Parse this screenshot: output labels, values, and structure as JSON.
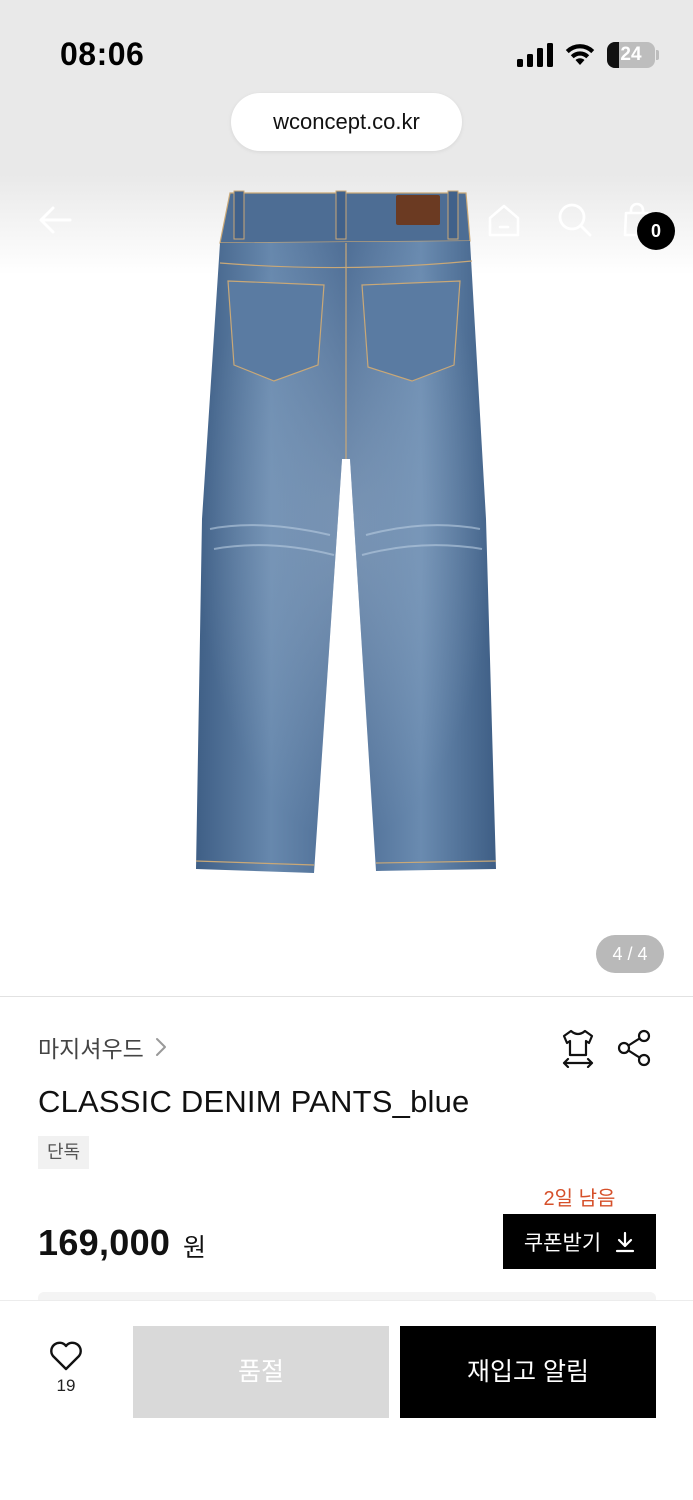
{
  "status_bar": {
    "time": "08:06",
    "battery_level": "24",
    "battery_fraction": 0.24,
    "url": "wconcept.co.kr"
  },
  "header": {
    "back_icon": "arrow-left-icon",
    "home_icon": "home-icon",
    "search_icon": "search-icon",
    "cart_icon": "shopping-bag-icon",
    "cart_count": "0"
  },
  "gallery": {
    "image_counter": "4 / 4"
  },
  "product": {
    "brand": "마지셔우드",
    "title": "CLASSIC DENIM PANTS_blue",
    "tag": "단독",
    "coupon_days_left": "2일 남음",
    "price": "169,000",
    "price_unit": "원",
    "coupon_button_label": "쿠폰받기",
    "size_icon": "shirt-size-icon",
    "share_icon": "share-icon"
  },
  "bottom_bar": {
    "wish_icon": "heart-icon",
    "wish_count": "19",
    "soldout_label": "품절",
    "restock_label": "재입고 알림"
  },
  "colors": {
    "accent_orange": "#d6502a",
    "primary_black": "#000000",
    "disabled_gray": "#d9d9d9",
    "denim_blue": "#4e6f96"
  }
}
